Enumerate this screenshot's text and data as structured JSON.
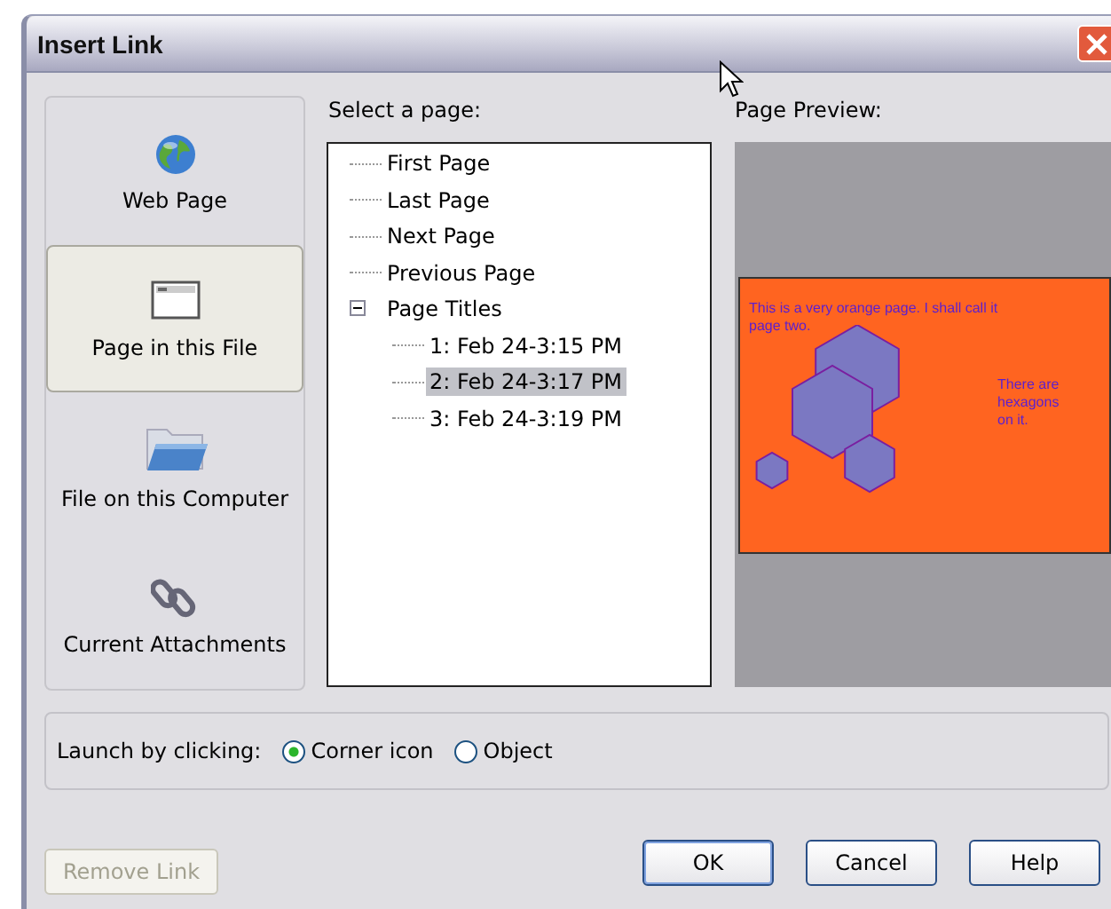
{
  "window": {
    "title": "Insert Link"
  },
  "sidebar": {
    "items": [
      {
        "label": "Web Page",
        "kind": "globe",
        "selected": false
      },
      {
        "label": "Page in this File",
        "kind": "page",
        "selected": true
      },
      {
        "label": "File on this Computer",
        "kind": "folder",
        "selected": false
      },
      {
        "label": "Current Attachments",
        "kind": "clip",
        "selected": false
      }
    ]
  },
  "page_list": {
    "label": "Select a page:",
    "items": [
      {
        "label": "First Page",
        "selected": false
      },
      {
        "label": "Last Page",
        "selected": false
      },
      {
        "label": "Next Page",
        "selected": false
      },
      {
        "label": "Previous Page",
        "selected": false
      },
      {
        "label": "Page Titles",
        "selected": false,
        "expanded": true,
        "children": [
          {
            "label": "1: Feb 24-3:15 PM",
            "selected": false
          },
          {
            "label": "2: Feb 24-3:17 PM",
            "selected": true
          },
          {
            "label": "3: Feb 24-3:19 PM",
            "selected": false
          }
        ]
      }
    ]
  },
  "preview": {
    "label": "Page Preview:",
    "texts": [
      "This is a very orange page. I shall call it page two.",
      "There are hexagons on it."
    ]
  },
  "launch": {
    "label": "Launch by clicking:",
    "options": [
      {
        "label": "Corner icon",
        "selected": true
      },
      {
        "label": "Object",
        "selected": false
      }
    ]
  },
  "buttons": [
    {
      "label": "Remove Link",
      "disabled": true,
      "default": false
    },
    {
      "label": "OK",
      "disabled": false,
      "default": true
    },
    {
      "label": "Cancel",
      "disabled": false,
      "default": false
    },
    {
      "label": "Help",
      "disabled": false,
      "default": false
    }
  ]
}
